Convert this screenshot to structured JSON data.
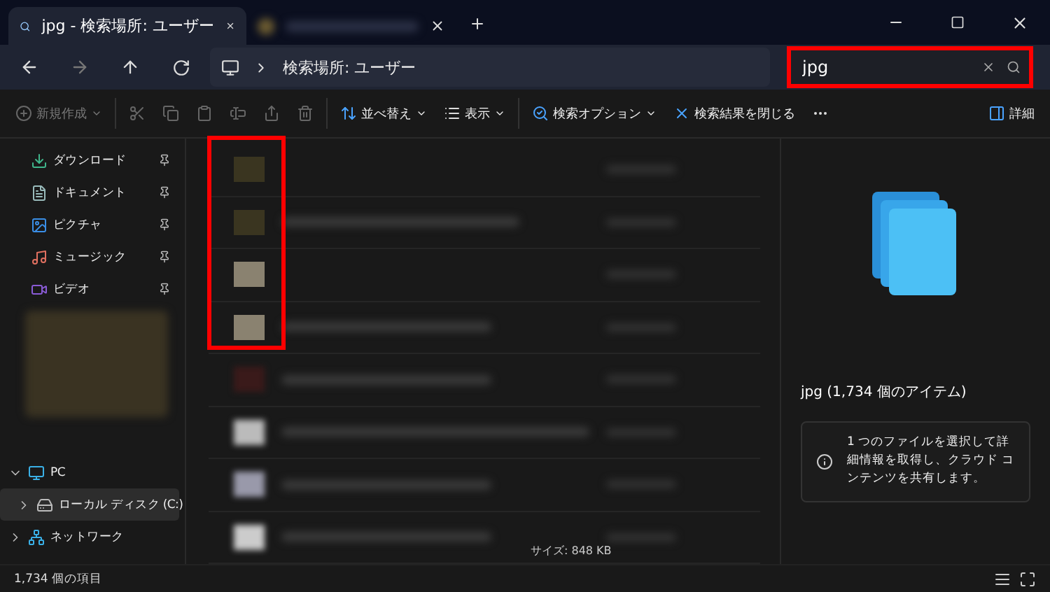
{
  "tabs": [
    {
      "label": "jpg - 検索場所: ユーザー",
      "selected": true
    },
    {
      "selected": false
    }
  ],
  "address": {
    "breadcrumb": "検索場所: ユーザー"
  },
  "search": {
    "value": "jpg"
  },
  "toolbar": [
    {
      "label": "新規作成",
      "disabled": true,
      "dropdown": true
    },
    {
      "disabled": true,
      "dropdown": false
    },
    {
      "disabled": true,
      "dropdown": false
    },
    {
      "disabled": true,
      "dropdown": false
    },
    {
      "disabled": true,
      "dropdown": false
    },
    {
      "disabled": true,
      "dropdown": false
    },
    {
      "disabled": true,
      "dropdown": false
    },
    {
      "label": "並べ替え",
      "disabled": false,
      "dropdown": true
    },
    {
      "label": "表示",
      "disabled": false,
      "dropdown": true
    },
    {
      "label": "検索オプション",
      "disabled": false,
      "dropdown": true
    },
    {
      "label": "検索結果を閉じる",
      "disabled": false,
      "dropdown": false
    },
    {
      "disabled": false,
      "dropdown": false
    }
  ],
  "details_button": {
    "label": "詳細"
  },
  "sidebar": {
    "quick_access": [
      {
        "label": "ダウンロード",
        "pinned": true
      },
      {
        "label": "ドキュメント",
        "pinned": true
      },
      {
        "label": "ピクチャ",
        "pinned": true
      },
      {
        "label": "ミュージック",
        "pinned": true
      },
      {
        "label": "ビデオ",
        "pinned": true
      }
    ],
    "tree": [
      {
        "label": "PC",
        "expanded": true,
        "selected": false,
        "children": [
          {
            "label": "ローカル ディスク (C:)",
            "expanded": false,
            "selected": true
          }
        ]
      },
      {
        "label": "ネットワーク",
        "expanded": false,
        "selected": false
      }
    ]
  },
  "file_list": {
    "size_tooltip": "サイズ: 848 KB"
  },
  "details": {
    "title": "jpg (1,734 個のアイテム)",
    "info": "1 つのファイルを選択して詳細情報を取得し、クラウド コンテンツを共有します。"
  },
  "status_bar": {
    "count": "1,734 個の項目"
  }
}
